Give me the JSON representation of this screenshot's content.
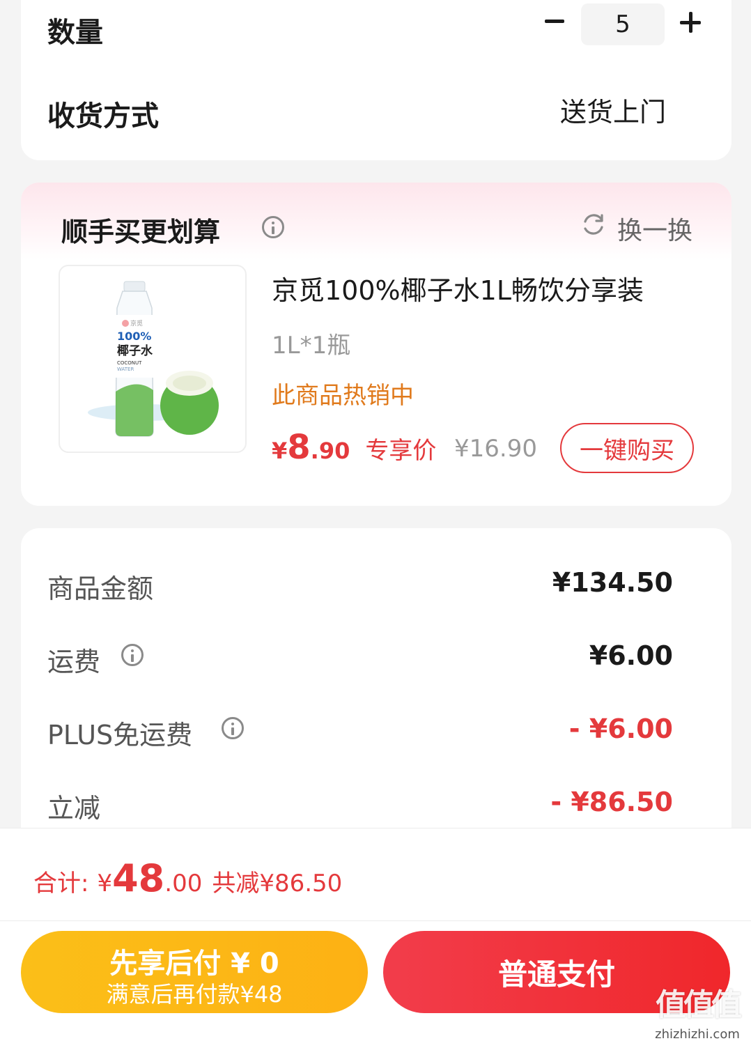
{
  "order": {
    "quantity_label": "数量",
    "quantity_value": "5",
    "delivery_label": "收货方式",
    "delivery_value": "送货上门"
  },
  "addon": {
    "title": "顺手买更划算",
    "refresh_label": "换一换",
    "product": {
      "name": "京觅100%椰子水1L畅饮分享装",
      "spec": "1L*1瓶",
      "status": "此商品热销中",
      "price_currency": "¥",
      "price_int": "8",
      "price_dec": ".90",
      "price_tag": "专享价",
      "original_price": "¥16.90",
      "buy_label": "一键购买",
      "image_text": {
        "brand": "京觅",
        "percent": "100%",
        "name": "椰子水",
        "en1": "COCONUT",
        "en2": "WATER"
      }
    }
  },
  "summary": {
    "rows": [
      {
        "label": "商品金额",
        "value": "¥134.50"
      },
      {
        "label": "运费",
        "value": "¥6.00"
      },
      {
        "label": "PLUS免运费",
        "value": "- ¥6.00"
      },
      {
        "label": "立减",
        "value": "- ¥86.50"
      }
    ]
  },
  "total": {
    "label": "合计:",
    "currency": "¥",
    "int": "48",
    "dec": ".00",
    "saved": "共减¥86.50"
  },
  "actions": {
    "later_line1": "先享后付 ¥ 0",
    "later_line2": "满意后再付款¥48",
    "pay_label": "普通支付"
  },
  "watermark": {
    "big": "值值值",
    "small": "zhizhizhi.com"
  },
  "colors": {
    "accent_red": "#e4393c",
    "hot_orange": "#e07a1c",
    "later_yellow": "#fbbf18"
  }
}
